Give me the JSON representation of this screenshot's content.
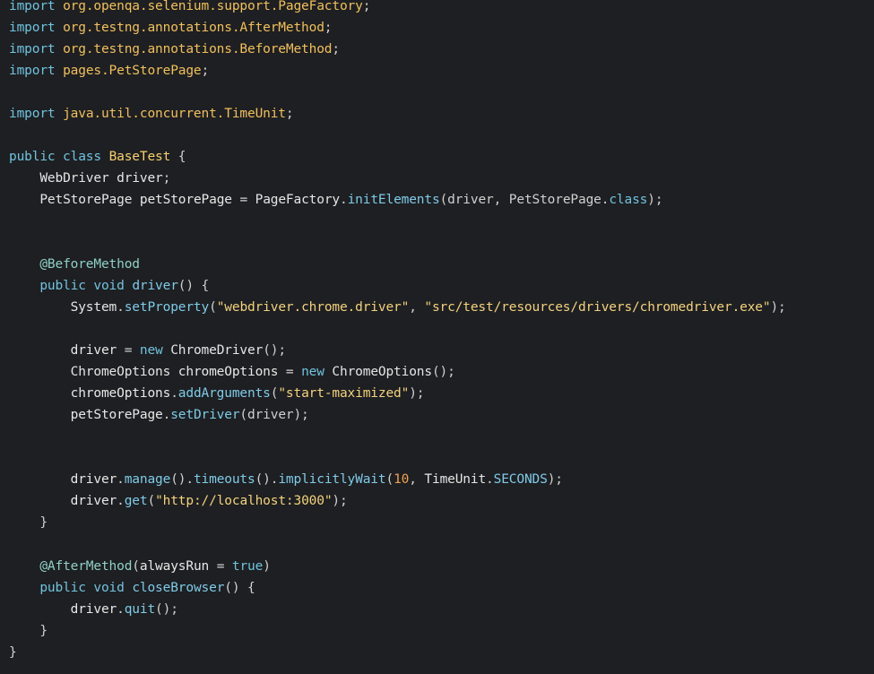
{
  "code": {
    "l1": {
      "kw": "import",
      "pkg": "org.openqa.selenium.support.PageFactory",
      "p": ";"
    },
    "l2": {
      "kw": "import",
      "pkg": "org.testng.annotations.AfterMethod",
      "p": ";"
    },
    "l3": {
      "kw": "import",
      "pkg": "org.testng.annotations.BeforeMethod",
      "p": ";"
    },
    "l4": {
      "kw": "import",
      "pkg": "pages.PetStorePage",
      "p": ";"
    },
    "l6": {
      "kw": "import",
      "pkg": "java.util.concurrent.TimeUnit",
      "p": ";"
    },
    "l8": {
      "kw": "public class",
      "name": "BaseTest",
      "p": " {"
    },
    "l9": {
      "ty": "WebDriver",
      "id": "driver",
      "p": ";"
    },
    "l10": {
      "ty": "PetStorePage",
      "id": "petStorePage",
      "eq": " = ",
      "obj": "PageFactory",
      "dot": ".",
      "fn": "initElements",
      "args": "(driver, PetStorePage.",
      "kwclass": "class",
      "end": ");"
    },
    "l13": {
      "ann": "@BeforeMethod"
    },
    "l14": {
      "kw": "public void",
      "fn": "driver",
      "p": "() {"
    },
    "l15": {
      "obj": "System",
      "dot": ".",
      "fn": "setProperty",
      "open": "(",
      "s1": "\"webdriver.chrome.driver\"",
      "comma": ", ",
      "s2": "\"src/test/resources/drivers/chromedriver.exe\"",
      "end": ");"
    },
    "l17": {
      "id": "driver",
      "eq": " = ",
      "kw": "new",
      "ty": "ChromeDriver",
      "end": "();"
    },
    "l18": {
      "ty": "ChromeOptions",
      "id": "chromeOptions",
      "eq": " = ",
      "kw": "new",
      "ty2": "ChromeOptions",
      "end": "();"
    },
    "l19": {
      "obj": "chromeOptions",
      "dot": ".",
      "fn": "addArguments",
      "open": "(",
      "s": "\"start-maximized\"",
      "end": ");"
    },
    "l20": {
      "obj": "petStorePage",
      "dot": ".",
      "fn": "setDriver",
      "args": "(driver);"
    },
    "l23": {
      "obj": "driver",
      "c1": ".",
      "fn1": "manage",
      "c2": "().",
      "fn2": "timeouts",
      "c3": "().",
      "fn3": "implicitlyWait",
      "open": "(",
      "num": "10",
      "comma": ", ",
      "tu": "TimeUnit",
      "dot": ".",
      "const": "SECONDS",
      "end": ");"
    },
    "l24": {
      "obj": "driver",
      "dot": ".",
      "fn": "get",
      "open": "(",
      "s": "\"http://localhost:3000\"",
      "end": ");"
    },
    "l25": {
      "p": "}"
    },
    "l27": {
      "ann": "@AfterMethod",
      "open": "(",
      "param": "alwaysRun",
      "eq": " = ",
      "val": "true",
      "end": ")"
    },
    "l28": {
      "kw": "public void",
      "fn": "closeBrowser",
      "p": "() {"
    },
    "l29": {
      "obj": "driver",
      "dot": ".",
      "fn": "quit",
      "end": "();"
    },
    "l30": {
      "p": "}"
    },
    "l31": {
      "p": "}"
    }
  },
  "colors": {
    "background": "#1e1f22",
    "keyword": "#6fc3df",
    "string": "#f3d27c",
    "number": "#f0a050",
    "annotation": "#8fd0c8"
  }
}
